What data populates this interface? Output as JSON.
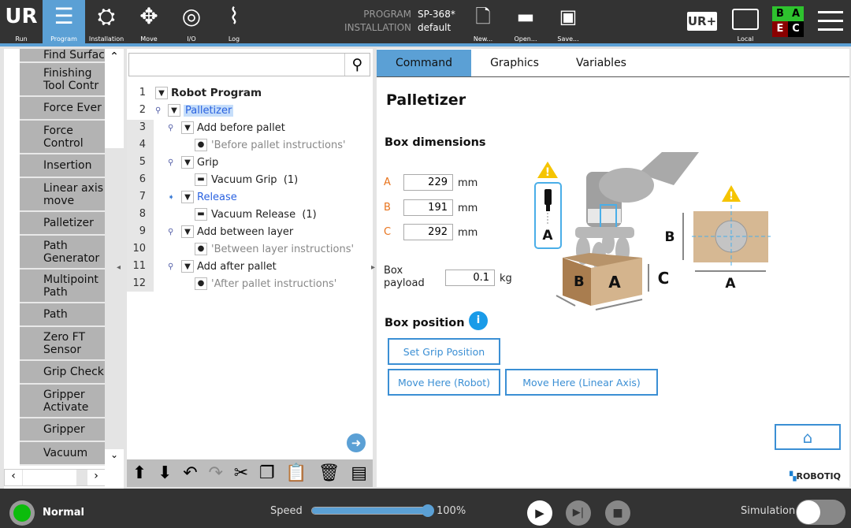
{
  "header": {
    "nav": [
      {
        "label": "Run",
        "icon": "ur-logo-icon"
      },
      {
        "label": "Program",
        "icon": "program-tree-icon",
        "active": true
      },
      {
        "label": "Installation",
        "icon": "robot-arm-icon"
      },
      {
        "label": "Move",
        "icon": "move-arrows-icon"
      },
      {
        "label": "I/O",
        "icon": "io-icon"
      },
      {
        "label": "Log",
        "icon": "log-icon"
      }
    ],
    "program_label": "PROGRAM",
    "program_value": "SP-368*",
    "installation_label": "INSTALLATION",
    "installation_value": "default",
    "file": [
      {
        "label": "New...",
        "icon": "new-file-icon"
      },
      {
        "label": "Open...",
        "icon": "folder-icon"
      },
      {
        "label": "Save...",
        "icon": "save-icon"
      }
    ],
    "local_label": "Local",
    "safety": {
      "B": "B",
      "A": "A",
      "E": "E",
      "C": "C"
    },
    "accent": "#5ba0d5"
  },
  "palette": {
    "items": [
      "Find Surface",
      "Finishing Tool Contr",
      "Force Ever",
      "Force Control",
      "Insertion",
      "Linear axis move",
      "Palletizer",
      "Path Generator",
      "Multipoint Path",
      "Path",
      "Zero FT Sensor",
      "Grip Check",
      "Gripper Activate",
      "Gripper",
      "Vacuum"
    ]
  },
  "tree": {
    "search_placeholder": "",
    "rows": [
      {
        "num": "1",
        "text": "Robot Program"
      },
      {
        "num": "2",
        "text": "Palletizer"
      },
      {
        "num": "3",
        "text": "Add before pallet"
      },
      {
        "num": "4",
        "text": "'Before pallet instructions'"
      },
      {
        "num": "5",
        "text": "Grip"
      },
      {
        "num": "6",
        "text": "Vacuum Grip  (1)"
      },
      {
        "num": "7",
        "text": "Release"
      },
      {
        "num": "8",
        "text": "Vacuum Release  (1)"
      },
      {
        "num": "9",
        "text": "Add between layer"
      },
      {
        "num": "10",
        "text": "'Between layer instructions'"
      },
      {
        "num": "11",
        "text": "Add after pallet"
      },
      {
        "num": "12",
        "text": "'After pallet instructions'"
      }
    ]
  },
  "tabs": [
    "Command",
    "Graphics",
    "Variables"
  ],
  "command": {
    "title": "Palletizer",
    "box_dimensions": "Box dimensions",
    "dims": [
      {
        "label": "A",
        "value": "229",
        "unit": "mm"
      },
      {
        "label": "B",
        "value": "191",
        "unit": "mm"
      },
      {
        "label": "C",
        "value": "292",
        "unit": "mm"
      }
    ],
    "payload_label": "Box payload",
    "payload_value": "0.1",
    "payload_unit": "kg",
    "box_position": "Box position",
    "set_grip": "Set Grip Position",
    "move_robot": "Move Here (Robot)",
    "move_linear": "Move Here (Linear Axis)",
    "diagram_labels": {
      "A": "A",
      "B": "B",
      "C": "C"
    },
    "brand": "ROBOTIQ"
  },
  "footer": {
    "status": "Normal",
    "speed_label": "Speed",
    "speed_value": "100%",
    "speed_fraction": 1.0,
    "simulation_label": "Simulation"
  }
}
